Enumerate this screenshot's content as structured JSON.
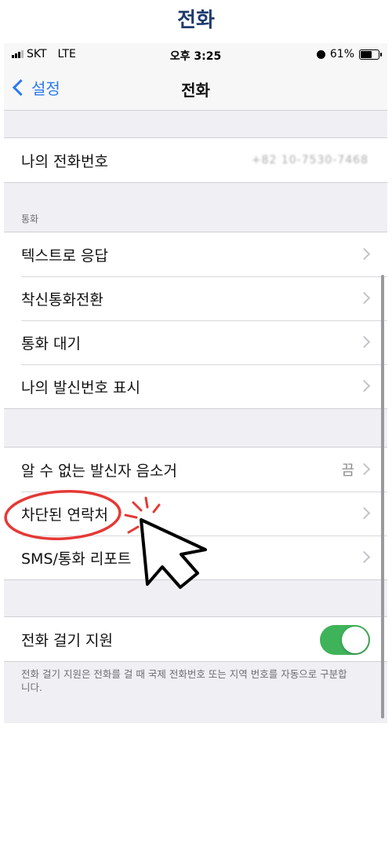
{
  "page_title": "전화",
  "status": {
    "carrier": "SKT",
    "network": "LTE",
    "time": "오후 3:25",
    "battery": "61%"
  },
  "nav": {
    "back_label": "설정",
    "title": "전화"
  },
  "my_number": {
    "label": "나의 전화번호",
    "value": "+82 10-7530-7468"
  },
  "calls_section": {
    "header": "통화",
    "items": [
      {
        "label": "텍스트로 응답"
      },
      {
        "label": "착신통화전환"
      },
      {
        "label": "통화 대기"
      },
      {
        "label": "나의 발신번호 표시"
      }
    ]
  },
  "blocking_section": {
    "items": [
      {
        "label": "알 수 없는 발신자 음소거",
        "value": "끔"
      },
      {
        "label": "차단된 연락처"
      },
      {
        "label": "SMS/통화 리포트"
      }
    ]
  },
  "dial_assist": {
    "label": "전화 걸기 지원",
    "enabled": true,
    "toggle_color": "#3fb35a",
    "note": "전화 걸기 지원은 전화를 걸 때 국제 전화번호 또는 지역 번호를 자동으로 구분합니다."
  },
  "annotation": {
    "highlight_color": "#e53935",
    "icon": "pointer-hand-icon"
  }
}
